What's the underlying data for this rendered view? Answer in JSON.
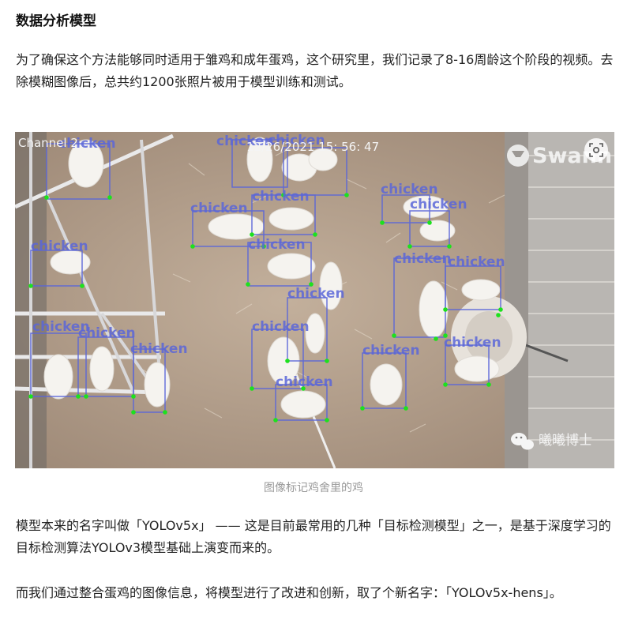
{
  "article": {
    "section_title": "数据分析模型",
    "paragraph_1": "为了确保这个方法能够同时适用于雏鸡和成年蛋鸡，这个研究里，我们记录了8-16周龄这个阶段的视频。去除模糊图像后，总共约1200张照片被用于模型训练和测试。",
    "paragraph_2": "模型本来的名字叫做「YOLOv5x」 —— 这是目前最常用的几种「目标检测模型」之一，是基于深度学习的目标检测算法YOLOv3模型基础上演变而来的。",
    "paragraph_3": "而我们通过整合蛋鸡的图像信息，将模型进行了改进和创新，取了个新名字：「YOLOv5x-hens」。"
  },
  "figure": {
    "caption": "图像标记鸡舍里的鸡",
    "camera_channel": "Channel 2",
    "camera_datetime": "12/26/2021  15: 56: 47",
    "camera_brand": "Swann",
    "watermark": "曦曦博士",
    "detection_label": "chicken",
    "scan_icon": "scan-icon",
    "colors": {
      "box": "#5a66d8",
      "keypoint": "#1de11d",
      "label": "#5a66d8"
    }
  }
}
